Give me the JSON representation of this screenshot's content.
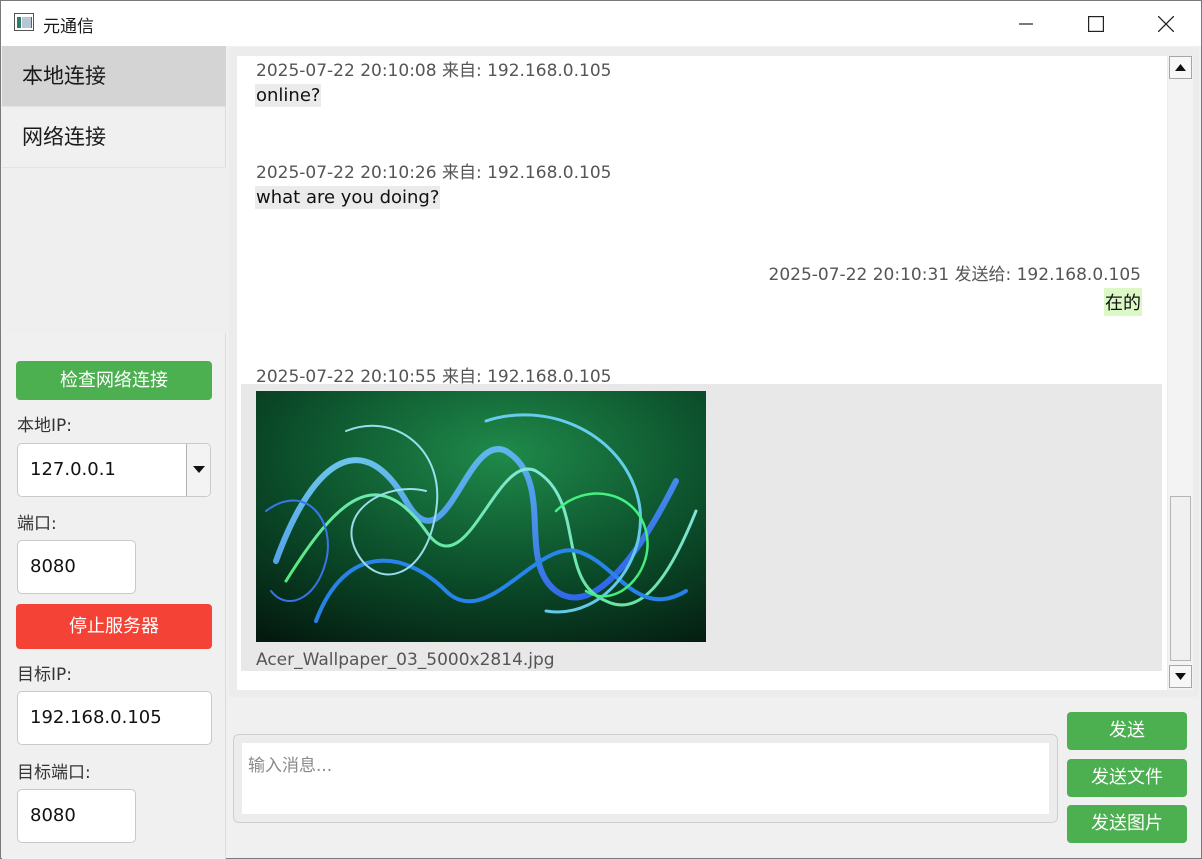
{
  "window": {
    "title": "元通信"
  },
  "nav": {
    "items": [
      {
        "label": "本地连接",
        "active": true
      },
      {
        "label": "网络连接",
        "active": false
      }
    ]
  },
  "settings": {
    "check_network_label": "检查网络连接",
    "local_ip_label": "本地IP:",
    "local_ip_value": "127.0.0.1",
    "port_label": "端口:",
    "port_value": "8080",
    "stop_server_label": "停止服务器",
    "target_ip_label": "目标IP:",
    "target_ip_value": "192.168.0.105",
    "target_port_label": "目标端口:",
    "target_port_value": "8080"
  },
  "messages": [
    {
      "meta": "2025-07-22 20:10:08 来自: 192.168.0.105",
      "text": "online?",
      "direction": "received"
    },
    {
      "meta": "2025-07-22 20:10:26 来自: 192.168.0.105",
      "text": "what are you doing?",
      "direction": "received"
    },
    {
      "meta": "2025-07-22 20:10:31 发送给: 192.168.0.105",
      "text": "在的",
      "direction": "sent"
    },
    {
      "meta": "2025-07-22 20:10:55 来自: 192.168.0.105",
      "image_name": "Acer_Wallpaper_03_5000x2814.jpg",
      "direction": "received"
    }
  ],
  "composer": {
    "placeholder": "输入消息...",
    "send_label": "发送",
    "send_file_label": "发送文件",
    "send_image_label": "发送图片"
  },
  "colors": {
    "accent_green": "#4caf50",
    "stop_red": "#f44336",
    "sent_bubble": "#dcf8c6",
    "received_bubble": "#ebebeb"
  }
}
